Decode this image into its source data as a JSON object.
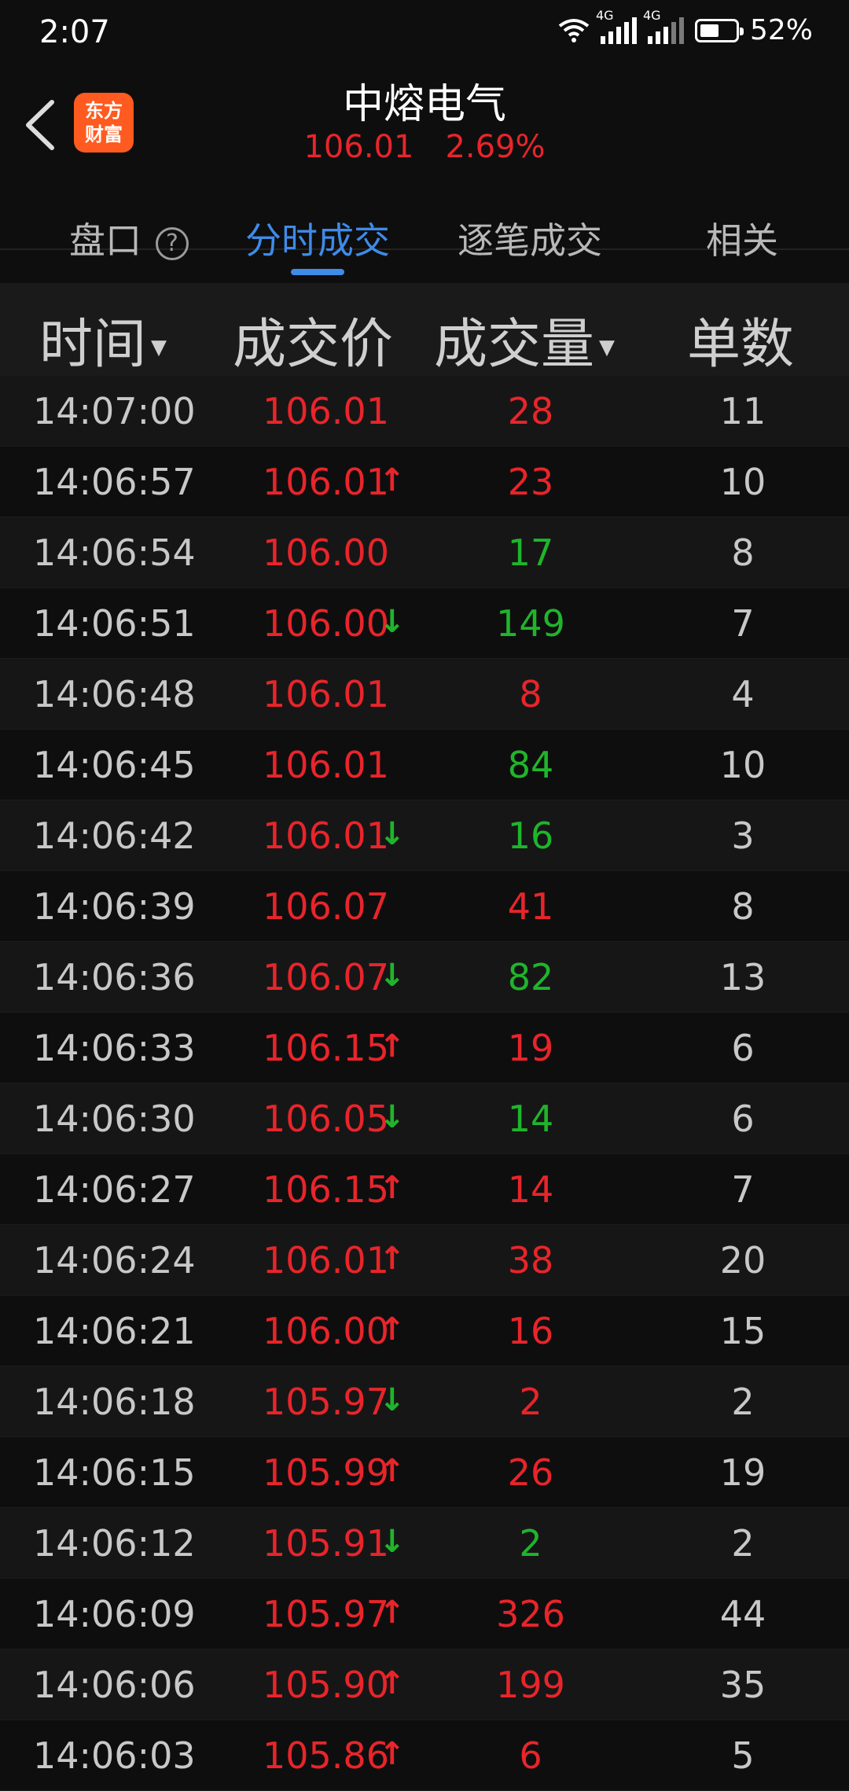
{
  "status_bar": {
    "time": "2:07",
    "network1": "4G",
    "network2": "4G",
    "battery": "52%",
    "battery_level": 0.52
  },
  "header": {
    "back_icon": "chevron-left-icon",
    "logo_line1": "东方",
    "logo_line2": "财富",
    "title": "中熔电气",
    "price": "106.01",
    "change": "2.69%"
  },
  "tabs": [
    {
      "label": "盘口",
      "active": false
    },
    {
      "label": "分时成交",
      "active": true
    },
    {
      "label": "逐笔成交",
      "active": false
    },
    {
      "label": "相关",
      "active": false
    }
  ],
  "columns": {
    "time": "时间",
    "price": "成交价",
    "volume": "成交量",
    "count": "单数"
  },
  "colors": {
    "up": "#e8252a",
    "down": "#1fb52b",
    "accent": "#3f8be8"
  },
  "trades": [
    {
      "time": "14:07:00",
      "price": "106.01",
      "arrow": "",
      "volume": "28",
      "vol_color": "red",
      "count": "11"
    },
    {
      "time": "14:06:57",
      "price": "106.01",
      "arrow": "up",
      "volume": "23",
      "vol_color": "red",
      "count": "10"
    },
    {
      "time": "14:06:54",
      "price": "106.00",
      "arrow": "",
      "volume": "17",
      "vol_color": "green",
      "count": "8"
    },
    {
      "time": "14:06:51",
      "price": "106.00",
      "arrow": "down",
      "volume": "149",
      "vol_color": "green",
      "count": "7"
    },
    {
      "time": "14:06:48",
      "price": "106.01",
      "arrow": "",
      "volume": "8",
      "vol_color": "red",
      "count": "4"
    },
    {
      "time": "14:06:45",
      "price": "106.01",
      "arrow": "",
      "volume": "84",
      "vol_color": "green",
      "count": "10"
    },
    {
      "time": "14:06:42",
      "price": "106.01",
      "arrow": "down",
      "volume": "16",
      "vol_color": "green",
      "count": "3"
    },
    {
      "time": "14:06:39",
      "price": "106.07",
      "arrow": "",
      "volume": "41",
      "vol_color": "red",
      "count": "8"
    },
    {
      "time": "14:06:36",
      "price": "106.07",
      "arrow": "down",
      "volume": "82",
      "vol_color": "green",
      "count": "13"
    },
    {
      "time": "14:06:33",
      "price": "106.15",
      "arrow": "up",
      "volume": "19",
      "vol_color": "red",
      "count": "6"
    },
    {
      "time": "14:06:30",
      "price": "106.05",
      "arrow": "down",
      "volume": "14",
      "vol_color": "green",
      "count": "6"
    },
    {
      "time": "14:06:27",
      "price": "106.15",
      "arrow": "up",
      "volume": "14",
      "vol_color": "red",
      "count": "7"
    },
    {
      "time": "14:06:24",
      "price": "106.01",
      "arrow": "up",
      "volume": "38",
      "vol_color": "red",
      "count": "20"
    },
    {
      "time": "14:06:21",
      "price": "106.00",
      "arrow": "up",
      "volume": "16",
      "vol_color": "red",
      "count": "15"
    },
    {
      "time": "14:06:18",
      "price": "105.97",
      "arrow": "down",
      "volume": "2",
      "vol_color": "red",
      "count": "2"
    },
    {
      "time": "14:06:15",
      "price": "105.99",
      "arrow": "up",
      "volume": "26",
      "vol_color": "red",
      "count": "19"
    },
    {
      "time": "14:06:12",
      "price": "105.91",
      "arrow": "down",
      "volume": "2",
      "vol_color": "green",
      "count": "2"
    },
    {
      "time": "14:06:09",
      "price": "105.97",
      "arrow": "up",
      "volume": "326",
      "vol_color": "red",
      "count": "44"
    },
    {
      "time": "14:06:06",
      "price": "105.90",
      "arrow": "up",
      "volume": "199",
      "vol_color": "red",
      "count": "35"
    },
    {
      "time": "14:06:03",
      "price": "105.86",
      "arrow": "up",
      "volume": "6",
      "vol_color": "red",
      "count": "5"
    }
  ]
}
